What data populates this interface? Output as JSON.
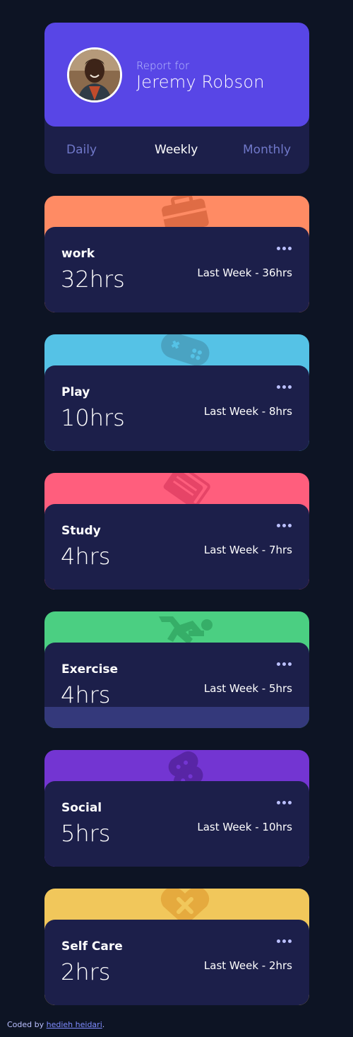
{
  "profile": {
    "report_for": "Report for",
    "name": "Jeremy Robson"
  },
  "tabs": [
    {
      "label": "Daily",
      "active": false
    },
    {
      "label": "Weekly",
      "active": true
    },
    {
      "label": "Monthly",
      "active": false
    }
  ],
  "cards": [
    {
      "title": "work",
      "hours": "32hrs",
      "previous": "Last Week - 36hrs",
      "color": "#ff8b64",
      "icon": "briefcase-icon"
    },
    {
      "title": "Play",
      "hours": "10hrs",
      "previous": "Last Week - 8hrs",
      "color": "#55c2e6",
      "icon": "gamepad-icon"
    },
    {
      "title": "Study",
      "hours": "4hrs",
      "previous": "Last Week - 7hrs",
      "color": "#ff5e7d",
      "icon": "book-icon"
    },
    {
      "title": "Exercise",
      "hours": "4hrs",
      "previous": "Last Week - 5hrs",
      "color": "#4bcf82",
      "icon": "running-icon"
    },
    {
      "title": "Social",
      "hours": "5hrs",
      "previous": "Last Week - 10hrs",
      "color": "#7335d2",
      "icon": "social-icon"
    },
    {
      "title": "Self Care",
      "hours": "2hrs",
      "previous": "Last Week - 2hrs",
      "color": "#f1c75b",
      "icon": "heart-icon"
    }
  ],
  "colors": {
    "background": "#0d1424",
    "card": "#1c1f4a",
    "accent": "#5846e6",
    "muted": "#7078c9",
    "pale": "#bbc0ff"
  },
  "attribution": {
    "prefix": "Coded by ",
    "author": "hedieh heidari",
    "suffix": "."
  }
}
